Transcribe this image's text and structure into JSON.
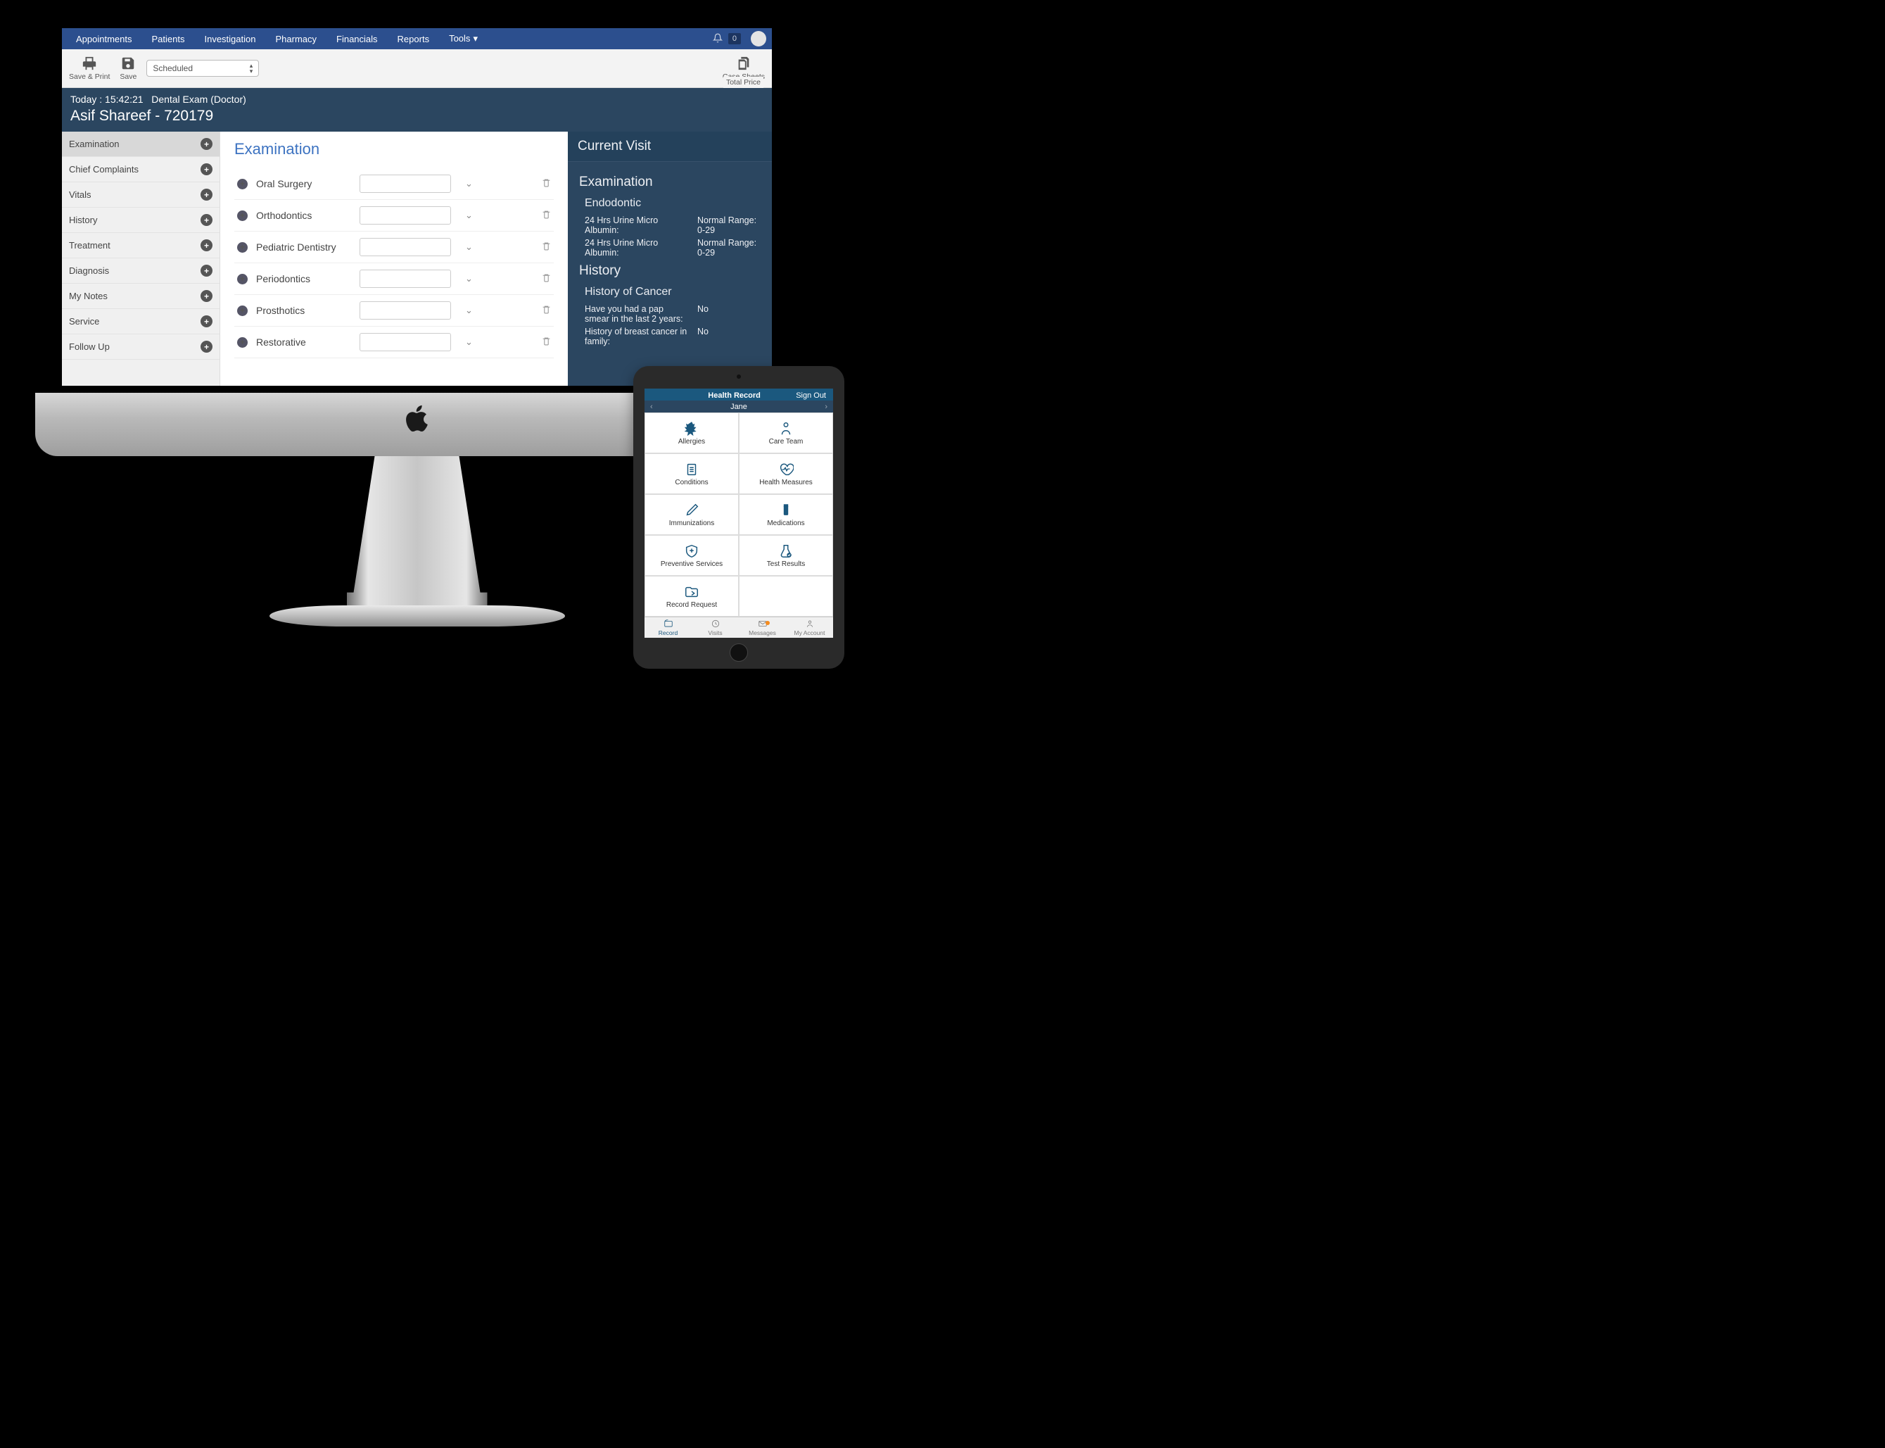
{
  "topnav": {
    "items": [
      "Appointments",
      "Patients",
      "Investigation",
      "Pharmacy",
      "Financials",
      "Reports",
      "Tools"
    ],
    "tools_has_caret": true,
    "notif_count": "0"
  },
  "toolbar": {
    "save_print": "Save & Print",
    "save": "Save",
    "dropdown_value": "Scheduled",
    "case_sheets": "Case Sheets",
    "total_price": "Total Price"
  },
  "context": {
    "today_label": "Today :",
    "time": "15:42:21",
    "visit_type": "Dental Exam (Doctor)",
    "patient_name": "Asif Shareef",
    "patient_id": "720179"
  },
  "sidebar": {
    "items": [
      "Examination",
      "Chief Complaints",
      "Vitals",
      "History",
      "Treatment",
      "Diagnosis",
      "My Notes",
      "Service",
      "Follow Up"
    ],
    "active_index": 0
  },
  "content": {
    "heading": "Examination",
    "rows": [
      "Oral Surgery",
      "Orthodontics",
      "Pediatric Dentistry",
      "Periodontics",
      "Prosthotics",
      "Restorative"
    ]
  },
  "right_pane": {
    "title": "Current Visit",
    "sections": [
      {
        "h3": "Examination",
        "h4": "Endodontic",
        "kv": [
          {
            "k": "24 Hrs Urine Micro Albumin:",
            "v": "Normal Range: 0-29"
          },
          {
            "k": "24 Hrs Urine Micro Albumin:",
            "v": "Normal Range: 0-29"
          }
        ]
      },
      {
        "h3": "History",
        "h4": "History of Cancer",
        "kv": [
          {
            "k": "Have you had a pap smear in the last 2 years:",
            "v": "No"
          },
          {
            "k": "History of breast cancer in family:",
            "v": "No"
          }
        ]
      }
    ]
  },
  "ipad": {
    "top_title": "Health Record",
    "sign_out": "Sign Out",
    "patient": "Jane",
    "grid": [
      "Allergies",
      "Care Team",
      "Conditions",
      "Health Measures",
      "Immunizations",
      "Medications",
      "Preventive Services",
      "Test Results",
      "Record Request"
    ],
    "tabs": [
      "Record",
      "Visits",
      "Messages",
      "My Account"
    ],
    "active_tab": 0,
    "badge_tab": 2
  }
}
